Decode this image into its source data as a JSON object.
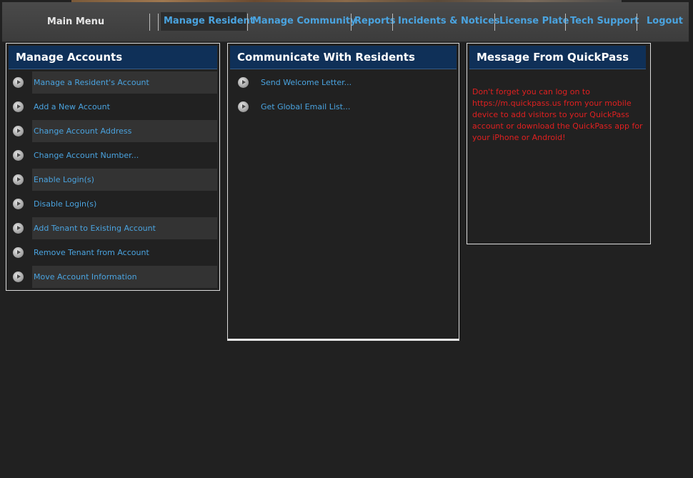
{
  "header": {
    "main_menu_label": "Main Menu",
    "nav": [
      {
        "label": "Manage Resident",
        "active": true
      },
      {
        "label": "Manage Community",
        "active": false
      },
      {
        "label": "Reports",
        "active": false
      },
      {
        "label": "Incidents & Notices",
        "active": false
      },
      {
        "label": "License Plate",
        "active": false
      },
      {
        "label": "Tech Support",
        "active": false
      },
      {
        "label": "Logout",
        "active": false
      }
    ]
  },
  "manage_accounts": {
    "title": "Manage Accounts",
    "items": [
      {
        "label": "Manage a Resident's Account"
      },
      {
        "label": "Add a New Account"
      },
      {
        "label": "Change Account Address"
      },
      {
        "label": "Change Account Number..."
      },
      {
        "label": "Enable Login(s)"
      },
      {
        "label": "Disable Login(s)"
      },
      {
        "label": "Add Tenant to Existing Account"
      },
      {
        "label": "Remove Tenant from Account"
      },
      {
        "label": "Move Account Information"
      }
    ]
  },
  "communicate": {
    "title": "Communicate With Residents",
    "items": [
      {
        "label": "Send Welcome Letter..."
      },
      {
        "label": "Get Global Email List..."
      }
    ]
  },
  "message": {
    "title": "Message From QuickPass",
    "text": "Don't forget you can log on to https://m.quickpass.us from your mobile device to add visitors to your QuickPass account or download the QuickPass app for your iPhone or Android!"
  },
  "colors": {
    "background": "#212121",
    "header_blue": "#0f3058",
    "link_blue": "#4aa3df",
    "message_red": "#e02020"
  }
}
